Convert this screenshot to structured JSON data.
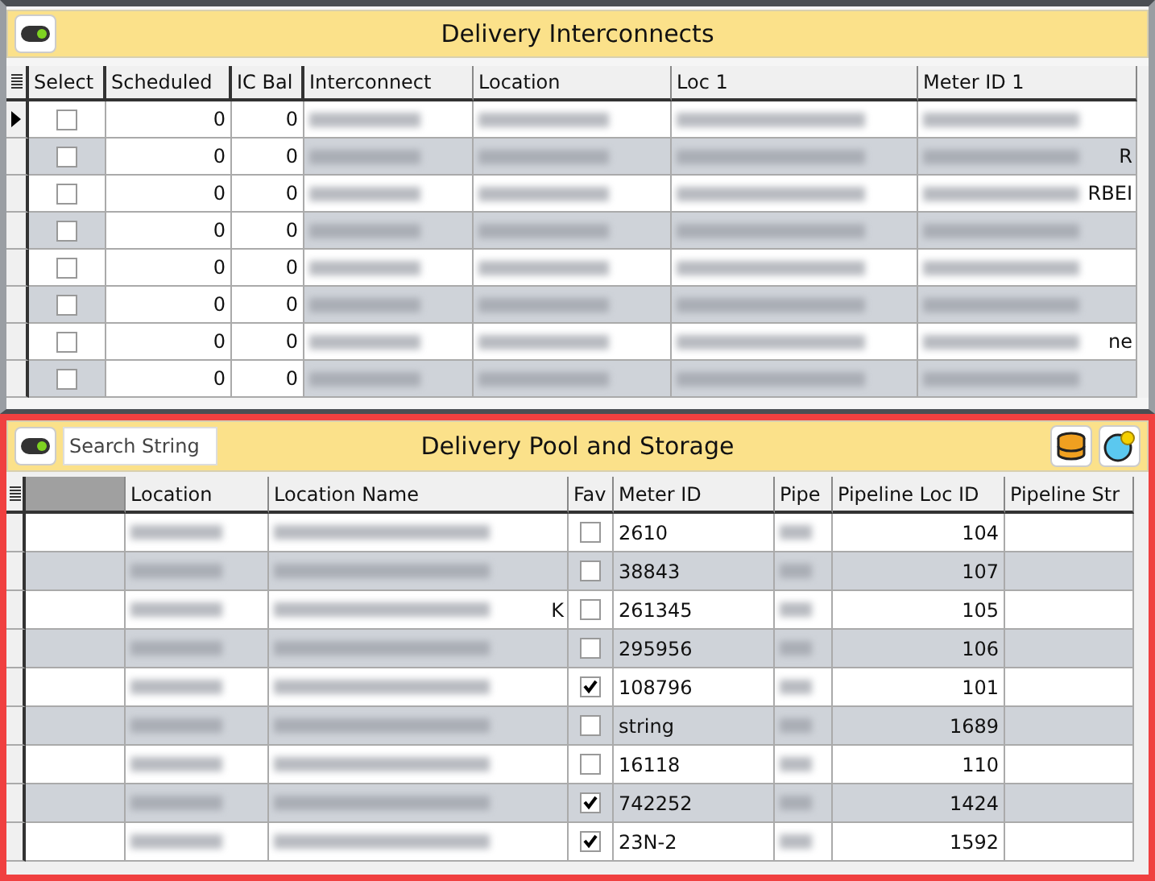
{
  "interconnects": {
    "toggle": {
      "on": true
    },
    "title": "Delivery Interconnects",
    "columns": [
      "Select",
      "Scheduled",
      "IC Bal",
      "Interconnect",
      "Location",
      "Loc 1",
      "Meter ID 1"
    ],
    "rows": [
      {
        "current": true,
        "select": false,
        "scheduled": "0",
        "ic_bal": "0"
      },
      {
        "current": false,
        "select": false,
        "scheduled": "0",
        "ic_bal": "0",
        "meter_id_1": "R"
      },
      {
        "current": false,
        "select": false,
        "scheduled": "0",
        "ic_bal": "0",
        "meter_id_1": "RBEI"
      },
      {
        "current": false,
        "select": false,
        "scheduled": "0",
        "ic_bal": "0"
      },
      {
        "current": false,
        "select": false,
        "scheduled": "0",
        "ic_bal": "0"
      },
      {
        "current": false,
        "select": false,
        "scheduled": "0",
        "ic_bal": "0"
      },
      {
        "current": false,
        "select": false,
        "scheduled": "0",
        "ic_bal": "0",
        "meter_id_1": "ne"
      },
      {
        "current": false,
        "select": false,
        "scheduled": "0",
        "ic_bal": "0"
      }
    ]
  },
  "pool_storage": {
    "toggle": {
      "on": true
    },
    "search": {
      "placeholder": "Search String"
    },
    "title": "Delivery Pool and Storage",
    "columns": [
      "Location",
      "Location Name",
      "Fav",
      "Meter ID",
      "Pipe",
      "Pipeline Loc ID",
      "Pipeline Str"
    ],
    "rows": [
      {
        "fav": false,
        "meter_id": "2610",
        "pipeline_loc_id": "104"
      },
      {
        "fav": false,
        "meter_id": "38843",
        "pipeline_loc_id": "107"
      },
      {
        "fav": false,
        "meter_id": "261345",
        "pipeline_loc_id": "105",
        "location_name": "K"
      },
      {
        "fav": false,
        "meter_id": "295956",
        "pipeline_loc_id": "106"
      },
      {
        "fav": true,
        "meter_id": "108796",
        "pipeline_loc_id": "101"
      },
      {
        "fav": false,
        "meter_id": "string",
        "pipeline_loc_id": "1689"
      },
      {
        "fav": false,
        "meter_id": "16118",
        "pipeline_loc_id": "110"
      },
      {
        "fav": true,
        "meter_id": "742252",
        "pipeline_loc_id": "1424"
      },
      {
        "fav": true,
        "meter_id": "23N-2",
        "pipeline_loc_id": "1592"
      }
    ]
  }
}
